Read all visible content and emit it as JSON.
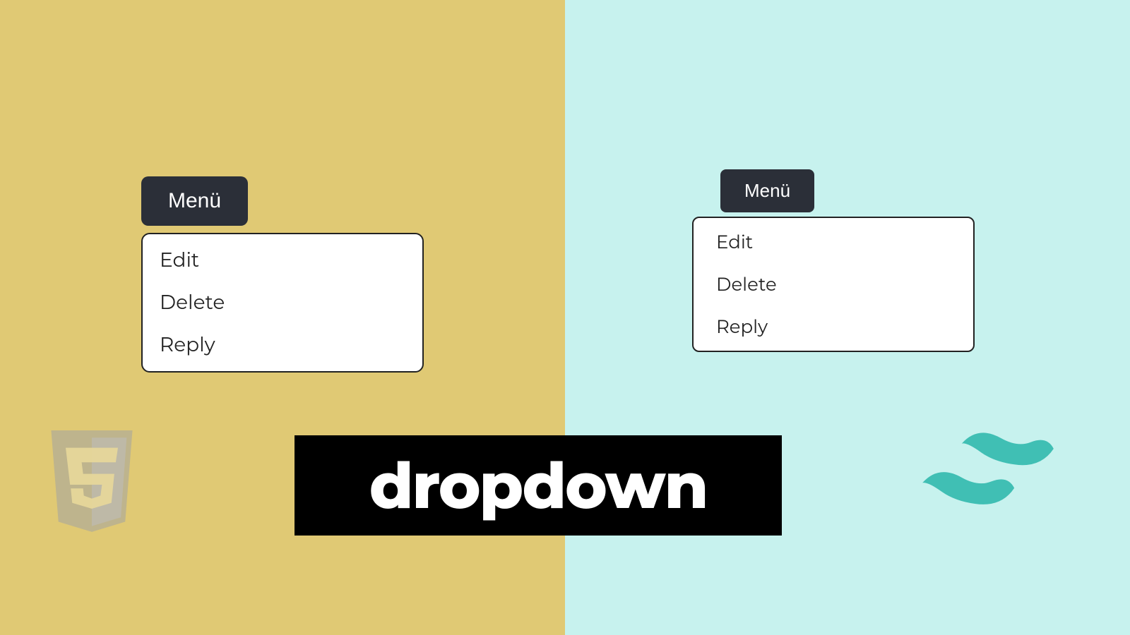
{
  "left": {
    "button_label": "Menü",
    "items": [
      "Edit",
      "Delete",
      "Reply"
    ]
  },
  "right": {
    "button_label": "Menü",
    "items": [
      "Edit",
      "Delete",
      "Reply"
    ]
  },
  "banner_text": "dropdown",
  "colors": {
    "left_bg": "#e0c974",
    "right_bg": "#c7f2ee",
    "button_bg": "#2b2f38",
    "tailwind": "#40bfb4"
  }
}
